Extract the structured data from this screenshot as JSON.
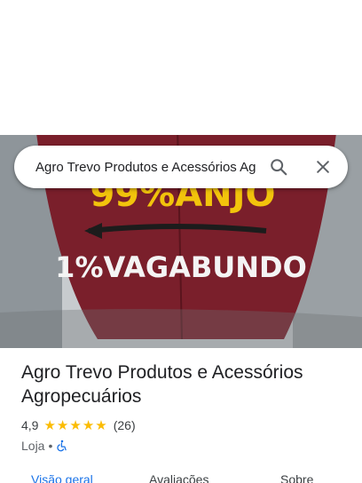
{
  "search": {
    "query": "Agro Trevo Produtos e Acessórios Agropecuários"
  },
  "place": {
    "name": "Agro Trevo Produtos e Acessórios Agropecuários",
    "rating": "4,9",
    "stars": 5,
    "review_count": "(26)",
    "category": "Loja",
    "separator": "•"
  },
  "photo": {
    "cap_line_top": "99%ANJO",
    "cap_line_main": "1%VAGABUNDO"
  },
  "tabs": [
    {
      "label": "Visão geral",
      "active": true
    },
    {
      "label": "Avaliações",
      "active": false
    },
    {
      "label": "Sobre",
      "active": false
    }
  ],
  "colors": {
    "accent": "#1a73e8",
    "star": "#fbbc04",
    "accessibility": "#1a73e8"
  },
  "icons": {
    "search": "search-icon",
    "close": "close-icon",
    "accessibility": "wheelchair-icon"
  }
}
